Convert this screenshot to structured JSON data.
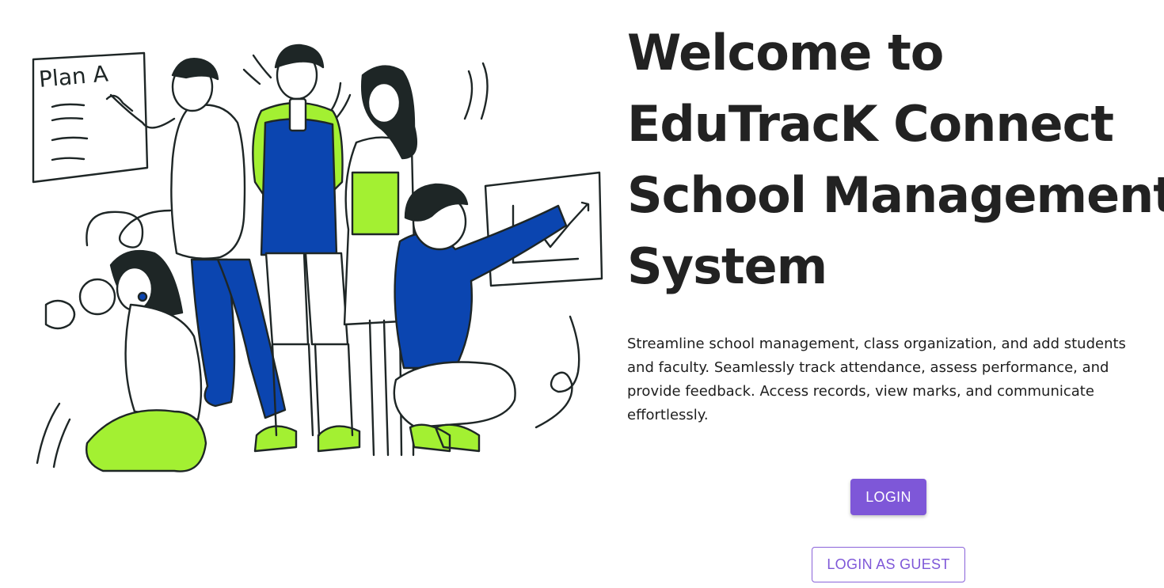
{
  "hero": {
    "title_lines": [
      "Welcome to",
      "EduTracK Connect",
      "School Management",
      "System"
    ],
    "description": "Streamline school management, class organization, and add students and faculty. Seamlessly track attendance, assess performance, and provide feedback. Access records, view marks, and communicate effortlessly."
  },
  "illustration": {
    "board_text": "Plan A"
  },
  "actions": {
    "login_label": "LOGIN",
    "guest_label": "LOGIN AS GUEST"
  },
  "colors": {
    "accent": "#7e57d8",
    "illustration_blue": "#0b45b0",
    "illustration_green": "#a3f032",
    "ink": "#1e2626"
  }
}
